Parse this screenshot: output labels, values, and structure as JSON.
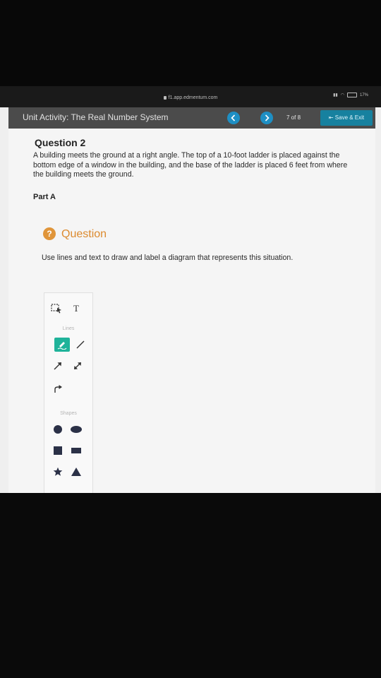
{
  "browser": {
    "url": "f1.app.edmentum.com",
    "battery": "17%"
  },
  "header": {
    "title": "Unit Activity: The Real Number System",
    "prev_icon": "chevron-left-icon",
    "next_icon": "chevron-right-icon",
    "counter": "7  of  8",
    "save_label": "Save & Exit"
  },
  "question": {
    "title": "Question 2",
    "text": "A building meets the ground at a right angle. The top of a 10-foot ladder is placed against the bottom edge of a window in the building, and the base of the ladder is placed 6 feet from where the building meets the ground.",
    "part": "Part A",
    "badge": "?",
    "heading": "Question",
    "instruction": "Use lines and text to draw and label a diagram that represents this situation."
  },
  "toolbox": {
    "lines_label": "Lines",
    "shapes_label": "Shapes",
    "text_tool": "T",
    "accent_color": "#1fb39a"
  },
  "colors": {
    "save_button": "#17819f",
    "nav_button": "#1e8fc4",
    "question_accent": "#e0953a"
  }
}
